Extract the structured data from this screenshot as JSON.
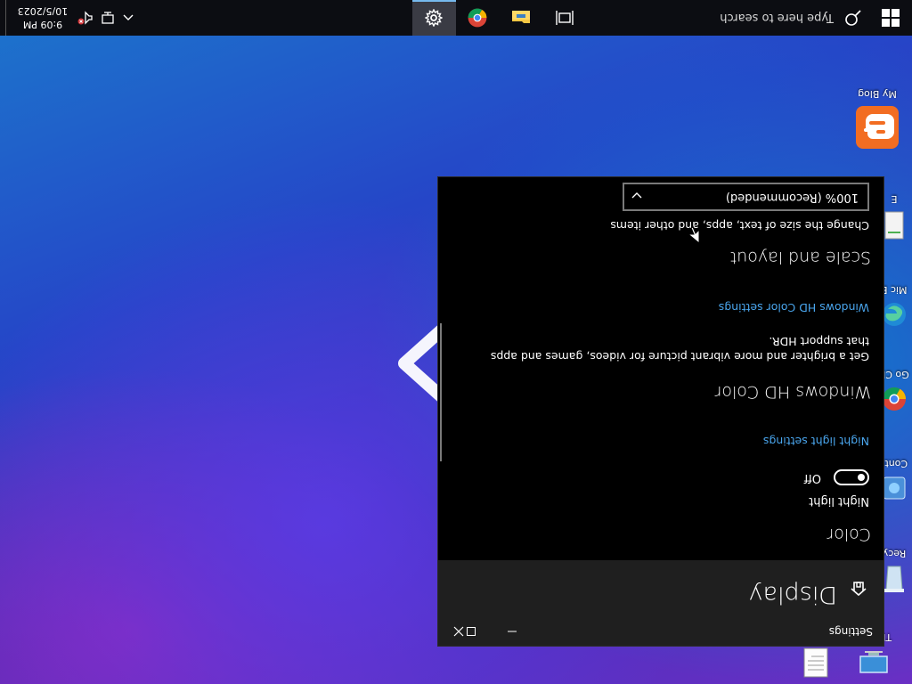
{
  "window": {
    "app_title": "Settings",
    "page_title": "Display"
  },
  "color_section": {
    "heading": "Color",
    "night_light_label": "Night light",
    "night_light_state": "Off",
    "night_light_link": "Night light settings"
  },
  "hdr_section": {
    "heading": "Windows HD Color",
    "description": "Get a brighter and more vibrant picture for videos, games and apps that support HDR.",
    "link": "Windows HD Color settings"
  },
  "scale_section": {
    "heading": "Scale and layout",
    "label": "Change the size of text, apps, and other items",
    "selected_value": "100% (Recommended)"
  },
  "taskbar": {
    "search_placeholder": "Type here to search",
    "apps": [
      "task-view",
      "file-explorer",
      "chrome",
      "settings"
    ],
    "active_app": "settings",
    "time": "9:09 PM",
    "date": "10/5/2023"
  },
  "desktop_icons": [
    {
      "label": "My Blog"
    },
    {
      "label": "This PC"
    },
    {
      "label": "Recy"
    },
    {
      "label": "Contr"
    },
    {
      "label": "Go Ch"
    },
    {
      "label": "Mic E"
    },
    {
      "label": "E"
    }
  ],
  "colors": {
    "accent_link": "#4aa6ee",
    "blog_orange": "#f26d22",
    "taskbar": "#0c0d12"
  }
}
